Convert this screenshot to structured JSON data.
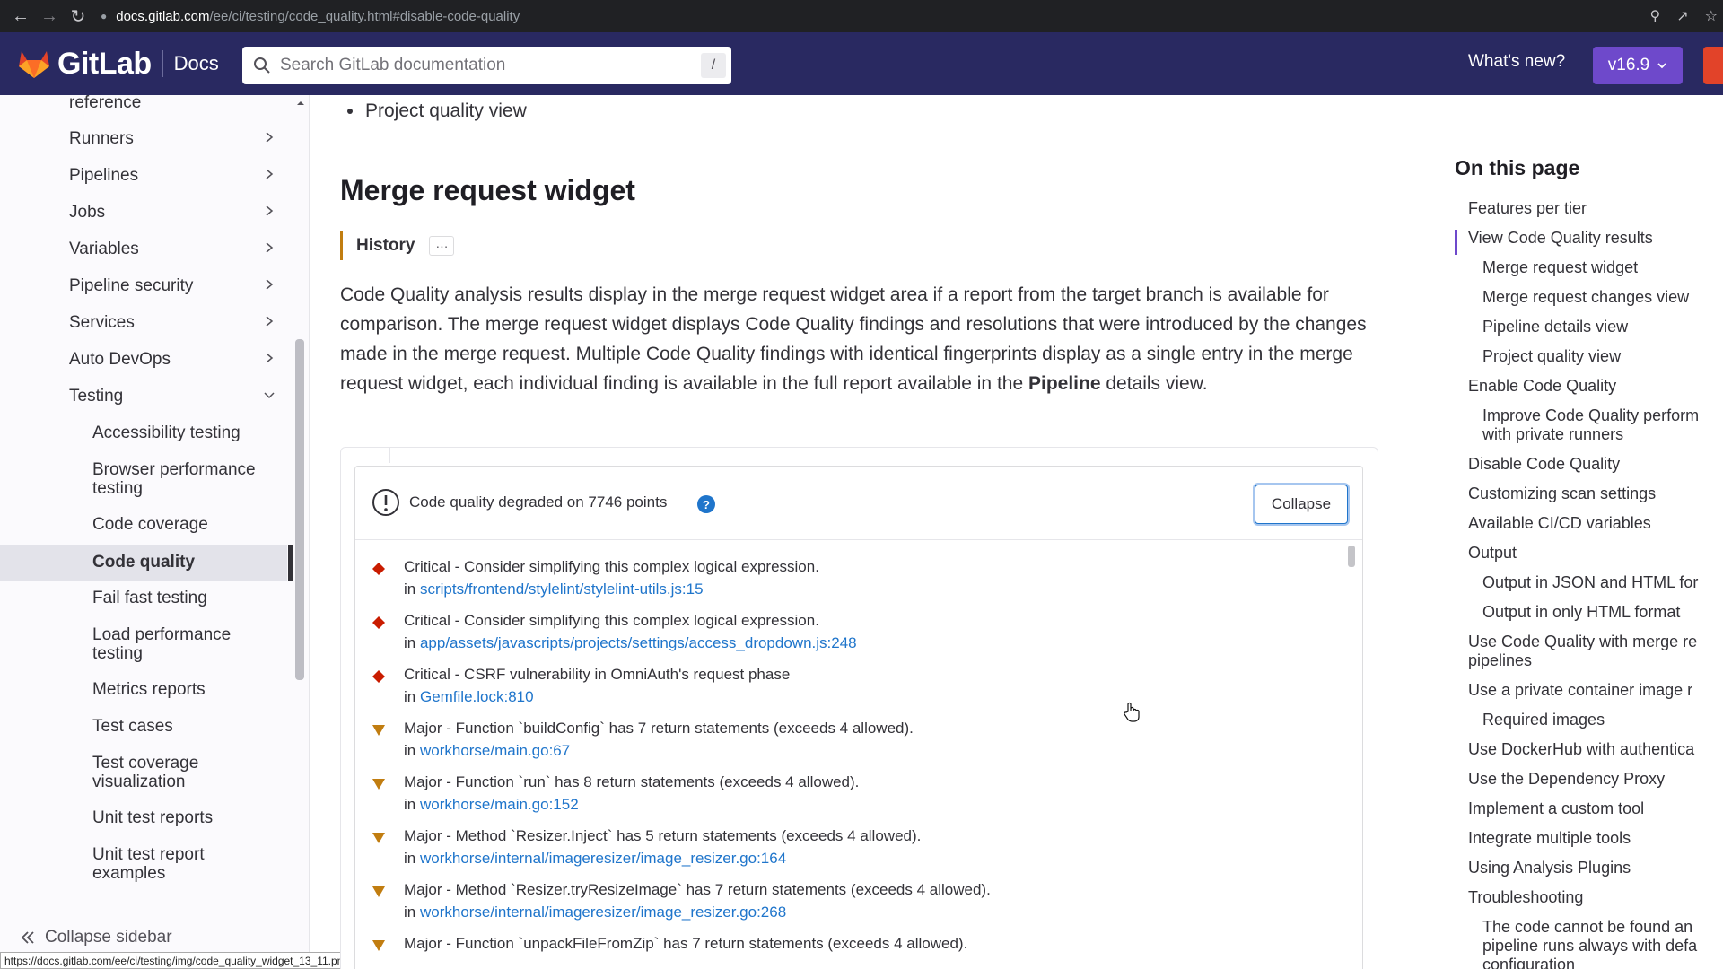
{
  "browser": {
    "url_host": "docs.gitlab.com",
    "url_path": "/ee/ci/testing/code_quality.html#disable-code-quality",
    "status_url": "https://docs.gitlab.com/ee/ci/testing/img/code_quality_widget_13_11.png"
  },
  "header": {
    "logo_text": "GitLab",
    "docs_label": "Docs",
    "search_placeholder": "Search GitLab documentation",
    "search_shortcut": "/",
    "whats_new": "What's new?",
    "version": "v16.9"
  },
  "sidebar": {
    "items": [
      {
        "label": "reference",
        "expandable": true
      },
      {
        "label": "Runners",
        "expandable": true
      },
      {
        "label": "Pipelines",
        "expandable": true
      },
      {
        "label": "Jobs",
        "expandable": true
      },
      {
        "label": "Variables",
        "expandable": true
      },
      {
        "label": "Pipeline security",
        "expandable": true
      },
      {
        "label": "Services",
        "expandable": true
      },
      {
        "label": "Auto DevOps",
        "expandable": true
      },
      {
        "label": "Testing",
        "expandable": true,
        "expanded": true
      }
    ],
    "subitems": [
      "Accessibility testing",
      "Browser performance testing",
      "Code coverage",
      "Code quality",
      "Fail fast testing",
      "Load performance testing",
      "Metrics reports",
      "Test cases",
      "Test coverage visualization",
      "Unit test reports",
      "Unit test report examples"
    ],
    "active_subitem": "Code quality",
    "collapse_label": "Collapse sidebar"
  },
  "main": {
    "bullet": "Project quality view",
    "heading": "Merge request widget",
    "history_label": "History",
    "history_more": "···",
    "paragraph_before": "Code Quality analysis results display in the merge request widget area if a report from the target branch is available for comparison. The merge request widget displays Code Quality findings and resolutions that were introduced by the changes made in the merge request. Multiple Code Quality findings with identical fingerprints display as a single entry in the merge request widget, each individual finding is available in the full report available in the ",
    "paragraph_bold": "Pipeline",
    "paragraph_after": " details view."
  },
  "widget": {
    "title": "Code quality degraded on 7746 points",
    "help": "?",
    "collapse_label": "Collapse",
    "in_label": "in",
    "findings": [
      {
        "severity": "critical",
        "text": "Critical - Consider simplifying this complex logical expression.",
        "location": "scripts/frontend/stylelint/stylelint-utils.js:15"
      },
      {
        "severity": "critical",
        "text": "Critical - Consider simplifying this complex logical expression.",
        "location": "app/assets/javascripts/projects/settings/access_dropdown.js:248"
      },
      {
        "severity": "critical",
        "text": "Critical - CSRF vulnerability in OmniAuth's request phase",
        "location": "Gemfile.lock:810"
      },
      {
        "severity": "major",
        "text": "Major - Function `buildConfig` has 7 return statements (exceeds 4 allowed).",
        "location": "workhorse/main.go:67"
      },
      {
        "severity": "major",
        "text": "Major - Function `run` has 8 return statements (exceeds 4 allowed).",
        "location": "workhorse/main.go:152"
      },
      {
        "severity": "major",
        "text": "Major - Method `Resizer.Inject` has 5 return statements (exceeds 4 allowed).",
        "location": "workhorse/internal/imageresizer/image_resizer.go:164"
      },
      {
        "severity": "major",
        "text": "Major - Method `Resizer.tryResizeImage` has 7 return statements (exceeds 4 allowed).",
        "location": "workhorse/internal/imageresizer/image_resizer.go:268"
      },
      {
        "severity": "major",
        "text": "Major - Function `unpackFileFromZip` has 7 return statements (exceeds 4 allowed).",
        "location": ""
      }
    ]
  },
  "toc": {
    "title": "On this page",
    "active": "View Code Quality results",
    "items": [
      {
        "label": "Features per tier",
        "level": 1
      },
      {
        "label": "View Code Quality results",
        "level": 1
      },
      {
        "label": "Merge request widget",
        "level": 2
      },
      {
        "label": "Merge request changes view",
        "level": 2
      },
      {
        "label": "Pipeline details view",
        "level": 2
      },
      {
        "label": "Project quality view",
        "level": 2
      },
      {
        "label": "Enable Code Quality",
        "level": 1
      },
      {
        "label": "Improve Code Quality perform",
        "label2": "with private runners",
        "level": 2
      },
      {
        "label": "Disable Code Quality",
        "level": 1
      },
      {
        "label": "Customizing scan settings",
        "level": 1
      },
      {
        "label": "Available CI/CD variables",
        "level": 1
      },
      {
        "label": "Output",
        "level": 1
      },
      {
        "label": "Output in JSON and HTML for",
        "level": 2
      },
      {
        "label": "Output in only HTML format",
        "level": 2
      },
      {
        "label": "Use Code Quality with merge re",
        "label2": "pipelines",
        "level": 1
      },
      {
        "label": "Use a private container image r",
        "level": 1
      },
      {
        "label": "Required images",
        "level": 2
      },
      {
        "label": "Use DockerHub with authentica",
        "level": 1
      },
      {
        "label": "Use the Dependency Proxy",
        "level": 1
      },
      {
        "label": "Implement a custom tool",
        "level": 1
      },
      {
        "label": "Integrate multiple tools",
        "level": 1
      },
      {
        "label": "Using Analysis Plugins",
        "level": 1
      },
      {
        "label": "Troubleshooting",
        "level": 1
      },
      {
        "label": "The code cannot be found an",
        "label2": "pipeline runs always with defa",
        "label3": "configuration",
        "level": 2
      }
    ]
  },
  "colors": {
    "header_bg": "#292961",
    "version_btn": "#6e49cb",
    "critical": "#c91c00",
    "major": "#c17d10",
    "link": "#1f75cb"
  }
}
